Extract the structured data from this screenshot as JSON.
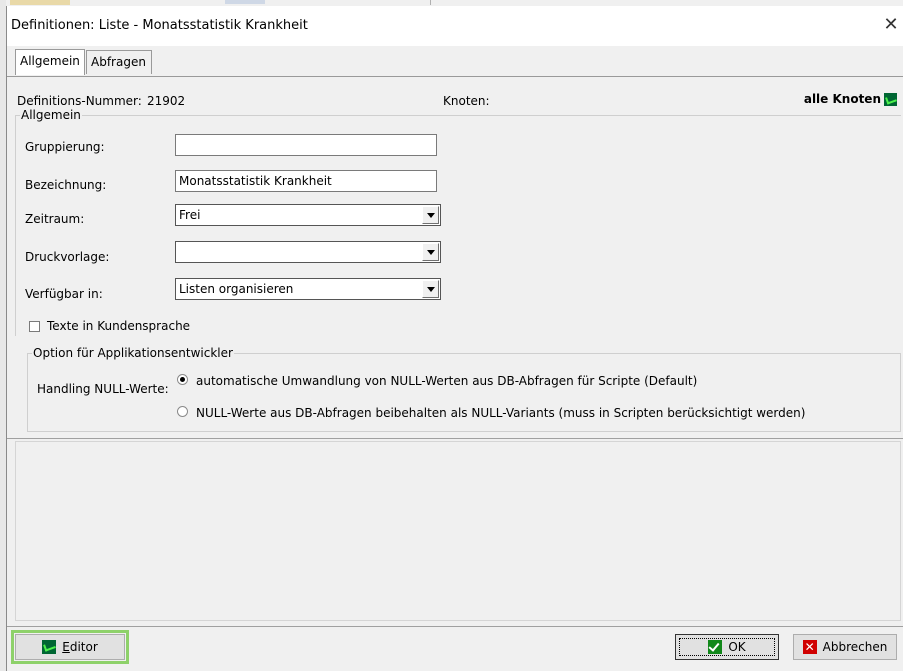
{
  "window": {
    "title": "Definitionen: Liste - Monatsstatistik Krankheit",
    "close_glyph": "✕"
  },
  "tabs": [
    {
      "label": "Allgemein",
      "active": true
    },
    {
      "label": "Abfragen",
      "active": false
    }
  ],
  "meta": {
    "definitions_nummer_label": "Definitions-Nummer:",
    "definitions_nummer_value": "21902",
    "knoten_label": "Knoten:",
    "knoten_value": "alle Knoten"
  },
  "allgemein": {
    "legend": "Allgemein",
    "gruppierung": {
      "label": "Gruppierung:",
      "value": ""
    },
    "bezeichnung": {
      "label": "Bezeichnung:",
      "value": "Monatsstatistik Krankheit"
    },
    "zeitraum": {
      "label": "Zeitraum:",
      "value": "Frei"
    },
    "druckvorlage": {
      "label": "Druckvorlage:",
      "value": ""
    },
    "verfuegbar": {
      "label": "Verfügbar in:",
      "value": "Listen organisieren"
    }
  },
  "kundensprache": {
    "label": "Texte in Kundensprache",
    "checked": false
  },
  "app_options": {
    "legend": "Option für Applikationsentwickler",
    "handling_label": "Handling NULL-Werte:",
    "options": [
      {
        "label": "automatische Umwandlung von NULL-Werten aus DB-Abfragen für Scripte (Default)",
        "selected": true
      },
      {
        "label": "NULL-Werte aus DB-Abfragen beibehalten als NULL-Variants (muss in Scripten berücksichtigt werden)",
        "selected": false
      }
    ]
  },
  "buttons": {
    "editor_prefix": "",
    "editor_mnemonic": "E",
    "editor_rest": "ditor",
    "ok": "OK",
    "cancel": "Abbrechen"
  },
  "colors": {
    "accent_highlight": "#8ed16a",
    "node_icon_bg": "#006633",
    "node_icon_fg": "#4df24d",
    "ok_icon": "#11881a",
    "cancel_icon": "#d00000"
  },
  "icons": {
    "close": "close-icon",
    "node": "node-icon",
    "editor": "editor-icon",
    "ok": "checkmark-icon",
    "cancel": "cancel-x-icon",
    "combo_arrow": "chevron-down-icon"
  }
}
